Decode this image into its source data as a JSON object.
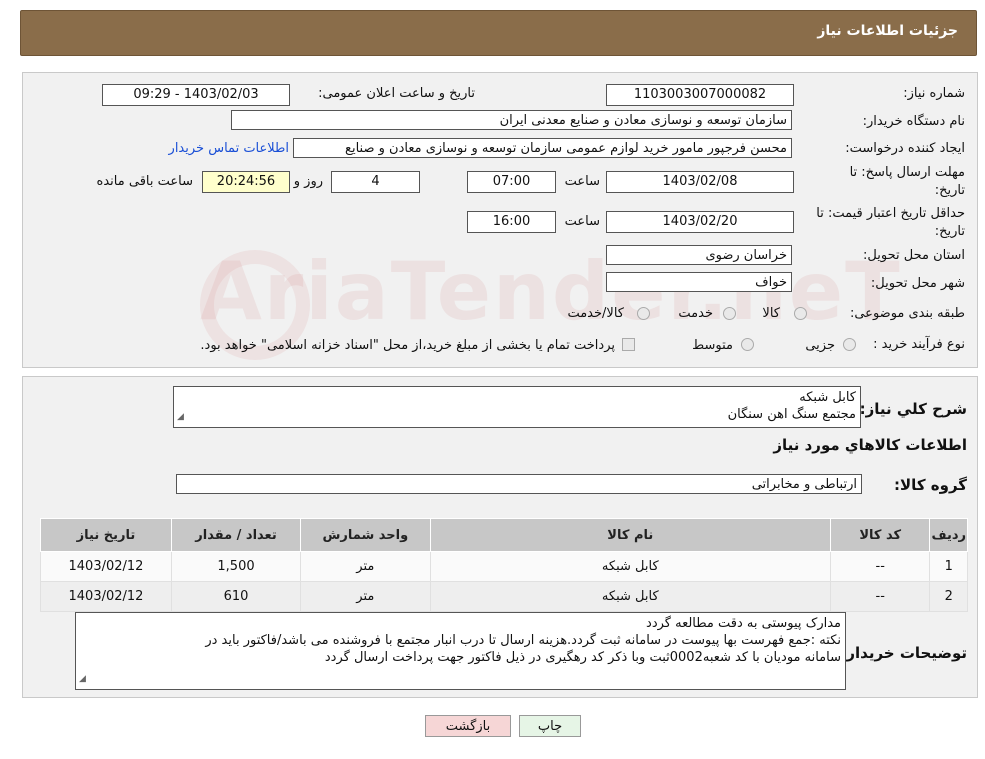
{
  "header": {
    "title": "جزئیات اطلاعات نیاز"
  },
  "form": {
    "need_number_label": "شماره نیاز:",
    "need_number": "1103003007000082",
    "announce_label": "تاریخ و ساعت اعلان عمومی:",
    "announce_value": "1403/02/03 - 09:29",
    "buyer_org_label": "نام دستگاه خریدار:",
    "buyer_org": "سازمان توسعه و نوسازی معادن و صنایع معدنی ایران",
    "creator_label": "ایجاد کننده درخواست:",
    "creator": "محسن فرجپور مامور خرید لوازم عمومی سازمان توسعه و نوسازی معادن و صنایع",
    "contact_link": "اطلاعات تماس خریدار",
    "reply_deadline_label_1": "مهلت ارسال پاسخ: تا",
    "reply_deadline_label_2": "تاریخ:",
    "reply_date": "1403/02/08",
    "time_label": "ساعت",
    "reply_time": "07:00",
    "days_value": "4",
    "days_label": "روز و",
    "remaining_time": "20:24:56",
    "remaining_label": "ساعت باقی مانده",
    "validity_label_1": "حداقل تاریخ اعتبار قیمت: تا",
    "validity_label_2": "تاریخ:",
    "validity_date": "1403/02/20",
    "validity_time": "16:00",
    "province_label": "استان محل تحویل:",
    "province": "خراسان رضوی",
    "city_label": "شهر محل تحویل:",
    "city": "خواف",
    "category_label": "طبقه بندی موضوعی:",
    "category_options": [
      "کالا",
      "خدمت",
      "کالا/خدمت"
    ],
    "process_label": "نوع فرآیند خرید :",
    "process_options": [
      "جزیی",
      "متوسط"
    ],
    "payment_note": "پرداخت تمام یا بخشی از مبلغ خرید،از محل \"اسناد خزانه اسلامی\" خواهد بود."
  },
  "summary": {
    "label": "شرح کلي نياز:",
    "line1": "کابل شبکه",
    "line2": "مجتمع سنگ اهن سنگان"
  },
  "goods_info_title": "اطلاعات کالاهاي مورد نياز",
  "goods_group": {
    "label": "گروه کالا:",
    "value": "ارتباطی و مخابراتی"
  },
  "table": {
    "headers": [
      "رديف",
      "کد کالا",
      "نام کالا",
      "واحد شمارش",
      "تعداد / مقدار",
      "تاريخ نياز"
    ],
    "rows": [
      [
        "1",
        "--",
        "کابل شبکه",
        "متر",
        "1,500",
        "1403/02/12"
      ],
      [
        "2",
        "--",
        "کابل شبکه",
        "متر",
        "610",
        "1403/02/12"
      ]
    ]
  },
  "buyer_notes": {
    "label": "توضیحات خریدار:",
    "line1": "مدارک پیوستی به دقت مطالعه گردد",
    "line2": "نکته :جمع فهرست بها پیوست در سامانه ثبت گردد.هزینه ارسال تا درب انبار مجتمع با فروشنده می باشد/فاکتور باید در",
    "line3": "سامانه مودیان با کد شعبه0002ثبت وبا ذکر کد رهگیری در ذیل فاکتور جهت پرداخت ارسال گردد"
  },
  "buttons": {
    "print": "چاپ",
    "back": "بازگشت"
  },
  "watermark": "AriaTender.neT",
  "colors": {
    "header": "#8a6d4a",
    "link": "#1a4fd6",
    "yellow": "#ffffcc",
    "back_button": "#f6d6d6"
  }
}
